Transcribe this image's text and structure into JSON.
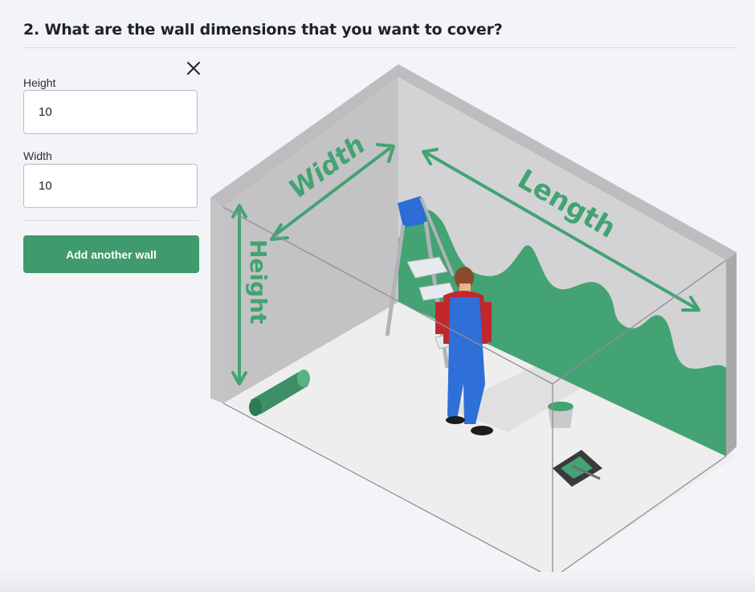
{
  "form": {
    "title": "2. What are the wall dimensions that you want to cover?",
    "height_label": "Height",
    "height_value": "10",
    "width_label": "Width",
    "width_value": "10",
    "add_wall_label": "Add another wall",
    "close_icon": "close-icon"
  },
  "illustration": {
    "width_label": "Width",
    "length_label": "Length",
    "height_label": "Height",
    "accent_color": "#43a372",
    "wall_color": "#c9c9cc"
  }
}
